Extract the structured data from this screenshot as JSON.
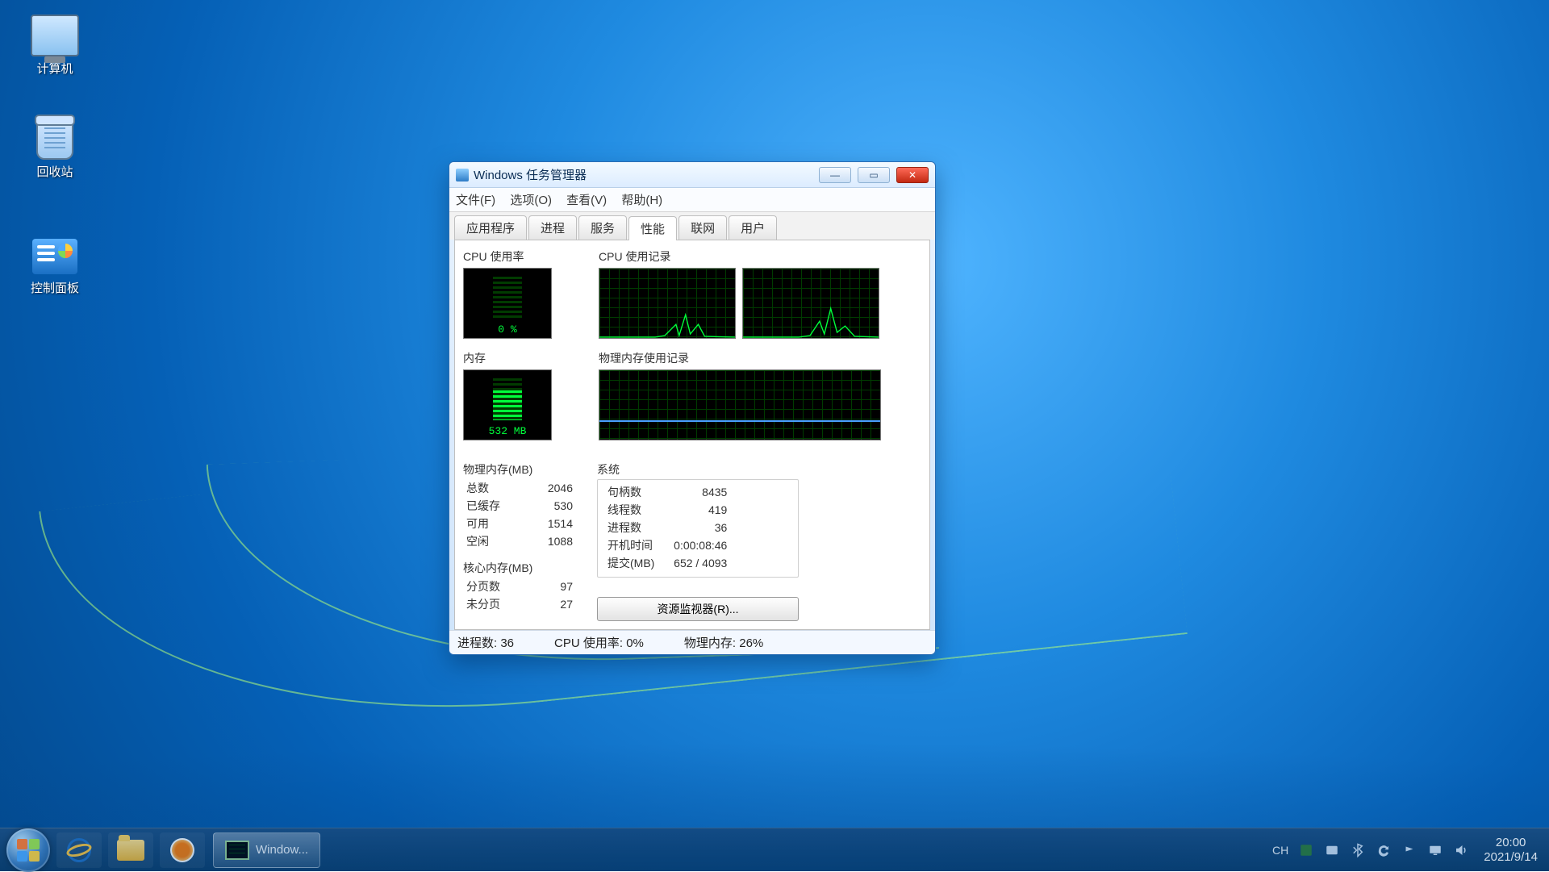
{
  "desktop": {
    "icons": {
      "computer": "计算机",
      "recycle": "回收站",
      "controlPanel": "控制面板"
    }
  },
  "taskbar": {
    "running": "Window...",
    "ime": "CH",
    "clock": {
      "time": "20:00",
      "date": "2021/9/14"
    }
  },
  "tm": {
    "title": "Windows 任务管理器",
    "menu": {
      "file": "文件(F)",
      "options": "选项(O)",
      "view": "查看(V)",
      "help": "帮助(H)"
    },
    "tabs": {
      "apps": "应用程序",
      "processes": "进程",
      "services": "服务",
      "performance": "性能",
      "networking": "联网",
      "users": "用户"
    },
    "labels": {
      "cpuUsage": "CPU 使用率",
      "cpuHistory": "CPU 使用记录",
      "memory": "内存",
      "memHistory": "物理内存使用记录",
      "physMem": "物理内存(MB)",
      "kernelMem": "核心内存(MB)",
      "system": "系统",
      "resourceMonitor": "资源监视器(R)..."
    },
    "gauge": {
      "cpu": "0 %",
      "mem": "532 MB"
    },
    "phys": {
      "total_l": "总数",
      "total_v": "2046",
      "cached_l": "已缓存",
      "cached_v": "530",
      "avail_l": "可用",
      "avail_v": "1514",
      "free_l": "空闲",
      "free_v": "1088"
    },
    "kernel": {
      "paged_l": "分页数",
      "paged_v": "97",
      "nonpaged_l": "未分页",
      "nonpaged_v": "27"
    },
    "sys": {
      "handles_l": "句柄数",
      "handles_v": "8435",
      "threads_l": "线程数",
      "threads_v": "419",
      "procs_l": "进程数",
      "procs_v": "36",
      "uptime_l": "开机时间",
      "uptime_v": "0:00:08:46",
      "commit_l": "提交(MB)",
      "commit_v": "652 / 4093"
    },
    "status": {
      "procs": "进程数: 36",
      "cpu": "CPU 使用率: 0%",
      "mem": "物理内存: 26%"
    }
  }
}
